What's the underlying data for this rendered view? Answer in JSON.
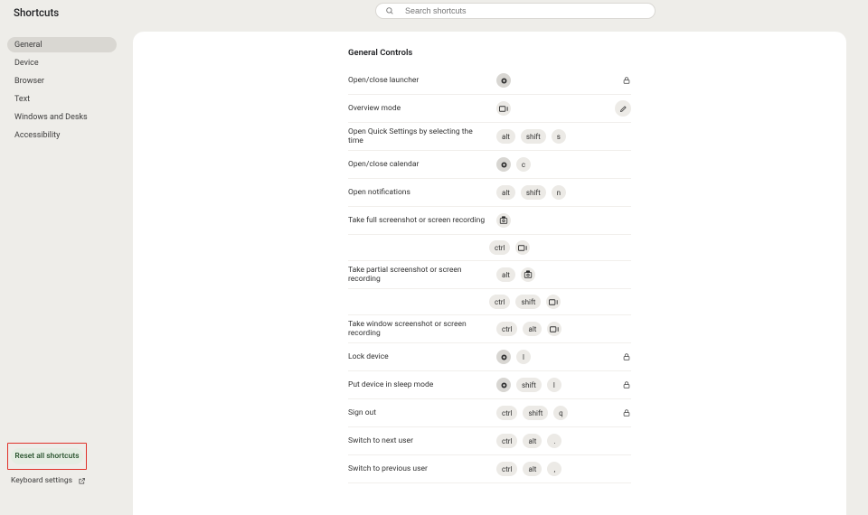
{
  "app_title": "Shortcuts",
  "search": {
    "placeholder": "Search shortcuts"
  },
  "sidebar": {
    "items": [
      {
        "label": "General",
        "active": true
      },
      {
        "label": "Device",
        "active": false
      },
      {
        "label": "Browser",
        "active": false
      },
      {
        "label": "Text",
        "active": false
      },
      {
        "label": "Windows and Desks",
        "active": false
      },
      {
        "label": "Accessibility",
        "active": false
      }
    ],
    "reset_label": "Reset all shortcuts",
    "keyboard_settings_label": "Keyboard settings"
  },
  "section": {
    "title": "General Controls",
    "rows": [
      {
        "label": "Open/close launcher",
        "key_sets": [
          [
            "launcher"
          ]
        ],
        "trailing": "lock"
      },
      {
        "label": "Overview mode",
        "key_sets": [
          [
            "overview"
          ]
        ],
        "trailing": "edit"
      },
      {
        "label": "Open Quick Settings by selecting the time",
        "key_sets": [
          [
            "alt",
            "shift",
            "s"
          ]
        ],
        "trailing": ""
      },
      {
        "label": "Open/close calendar",
        "key_sets": [
          [
            "launcher",
            "c"
          ]
        ],
        "trailing": ""
      },
      {
        "label": "Open notifications",
        "key_sets": [
          [
            "alt",
            "shift",
            "n"
          ]
        ],
        "trailing": ""
      },
      {
        "label": "Take full screenshot or screen recording",
        "key_sets": [
          [
            "screenshot"
          ],
          [
            "ctrl",
            "overview"
          ]
        ],
        "trailing": ""
      },
      {
        "label": "Take partial screenshot or screen recording",
        "key_sets": [
          [
            "alt",
            "screenshot"
          ],
          [
            "ctrl",
            "shift",
            "overview"
          ]
        ],
        "trailing": ""
      },
      {
        "label": "Take window screenshot or screen recording",
        "key_sets": [
          [
            "ctrl",
            "alt",
            "overview"
          ]
        ],
        "trailing": ""
      },
      {
        "label": "Lock device",
        "key_sets": [
          [
            "launcher",
            "l"
          ]
        ],
        "trailing": "lock"
      },
      {
        "label": "Put device in sleep mode",
        "key_sets": [
          [
            "launcher",
            "shift",
            "l"
          ]
        ],
        "trailing": "lock"
      },
      {
        "label": "Sign out",
        "key_sets": [
          [
            "ctrl",
            "shift",
            "q"
          ]
        ],
        "trailing": "lock"
      },
      {
        "label": "Switch to next user",
        "key_sets": [
          [
            "ctrl",
            "alt",
            "."
          ]
        ],
        "trailing": ""
      },
      {
        "label": "Switch to previous user",
        "key_sets": [
          [
            "ctrl",
            "alt",
            ","
          ]
        ],
        "trailing": ""
      }
    ]
  },
  "key_icons": {
    "launcher": "launcher-icon",
    "overview": "overview-icon",
    "screenshot": "screenshot-icon"
  }
}
